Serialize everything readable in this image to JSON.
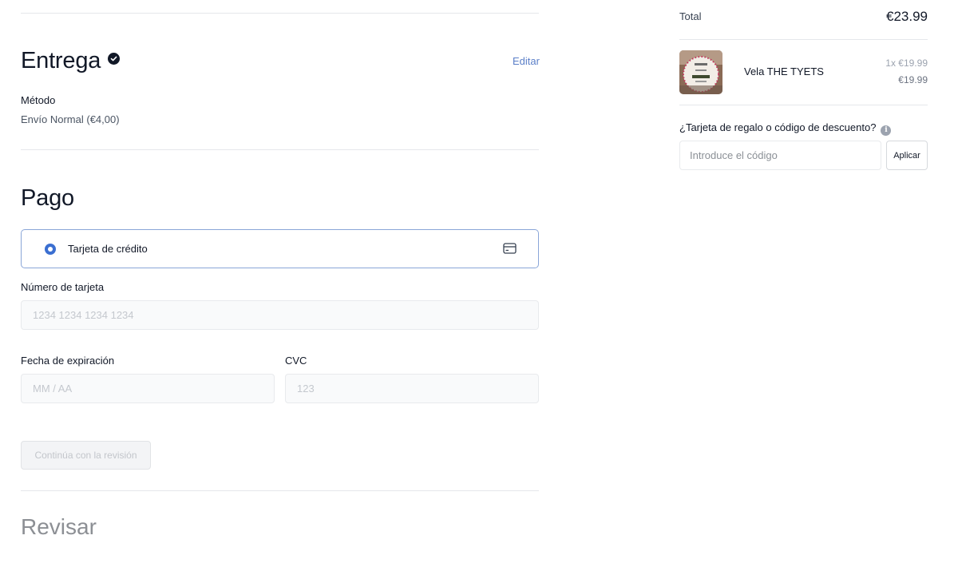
{
  "delivery": {
    "title": "Entrega",
    "edit_label": "Editar",
    "method_label": "Método",
    "method_value": "Envío Normal (€4,00)"
  },
  "payment": {
    "title": "Pago",
    "option_label": "Tarjeta de crédito",
    "card_number_label": "Número de tarjeta",
    "card_number_placeholder": "1234 1234 1234 1234",
    "expiry_label": "Fecha de expiración",
    "expiry_placeholder": "MM / AA",
    "cvc_label": "CVC",
    "cvc_placeholder": "123",
    "continue_label": "Continúa con la revisión"
  },
  "review": {
    "title": "Revisar"
  },
  "summary": {
    "total_label": "Total",
    "total_value": "€23.99",
    "item": {
      "name": "Vela THE TYETS",
      "qty_price": "1x €19.99",
      "price": "€19.99"
    },
    "gift_label": "¿Tarjeta de regalo o código de descuento?",
    "code_placeholder": "Introduce el código",
    "apply_label": "Aplicar"
  },
  "colors": {
    "accent": "#3b6fd1",
    "link": "#5b7fc8"
  }
}
